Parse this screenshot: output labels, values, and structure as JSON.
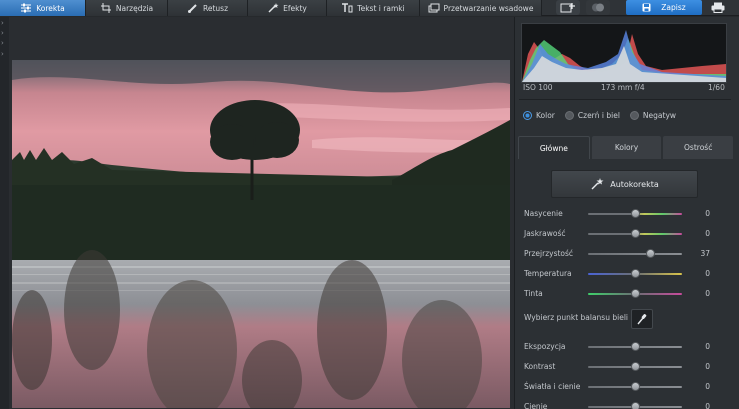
{
  "toolbar": {
    "tabs": [
      {
        "label": "Korekta",
        "icon": "sliders-icon",
        "active": true
      },
      {
        "label": "Narzędzia",
        "icon": "crop-icon"
      },
      {
        "label": "Retusz",
        "icon": "brush-icon"
      },
      {
        "label": "Efekty",
        "icon": "magic-wand-icon"
      },
      {
        "label": "Tekst i ramki",
        "icon": "text-icon"
      },
      {
        "label": "Przetwarzanie wsadowe",
        "icon": "batch-icon"
      }
    ],
    "save_label": "Zapisz",
    "accent_color": "#2a7bd2"
  },
  "histogram": {
    "iso": "ISO 100",
    "lens": "173 mm f/4",
    "shutter": "1/60"
  },
  "color_mode": {
    "options": [
      "Kolor",
      "Czerń i biel",
      "Negatyw"
    ],
    "selected": "Kolor"
  },
  "subtabs": [
    "Główne",
    "Kolory",
    "Ostrość"
  ],
  "autocorrect_label": "Autokorekta",
  "adjustments_top": [
    {
      "label": "Nasycenie",
      "value": "0",
      "pos": 0.5
    },
    {
      "label": "Jaskrawość",
      "value": "0",
      "pos": 0.5
    },
    {
      "label": "Przejrzystość",
      "value": "37",
      "pos": 0.66
    },
    {
      "label": "Temperatura",
      "value": "0",
      "pos": 0.5
    },
    {
      "label": "Tinta",
      "value": "0",
      "pos": 0.5
    }
  ],
  "white_balance_label": "Wybierz punkt balansu bieli",
  "adjustments_bottom": [
    {
      "label": "Ekspozycja",
      "value": "0",
      "pos": 0.5
    },
    {
      "label": "Kontrast",
      "value": "0",
      "pos": 0.5
    },
    {
      "label": "Światła i cienie",
      "value": "0",
      "pos": 0.5
    },
    {
      "label": "Cienie",
      "value": "0",
      "pos": 0.5
    }
  ]
}
